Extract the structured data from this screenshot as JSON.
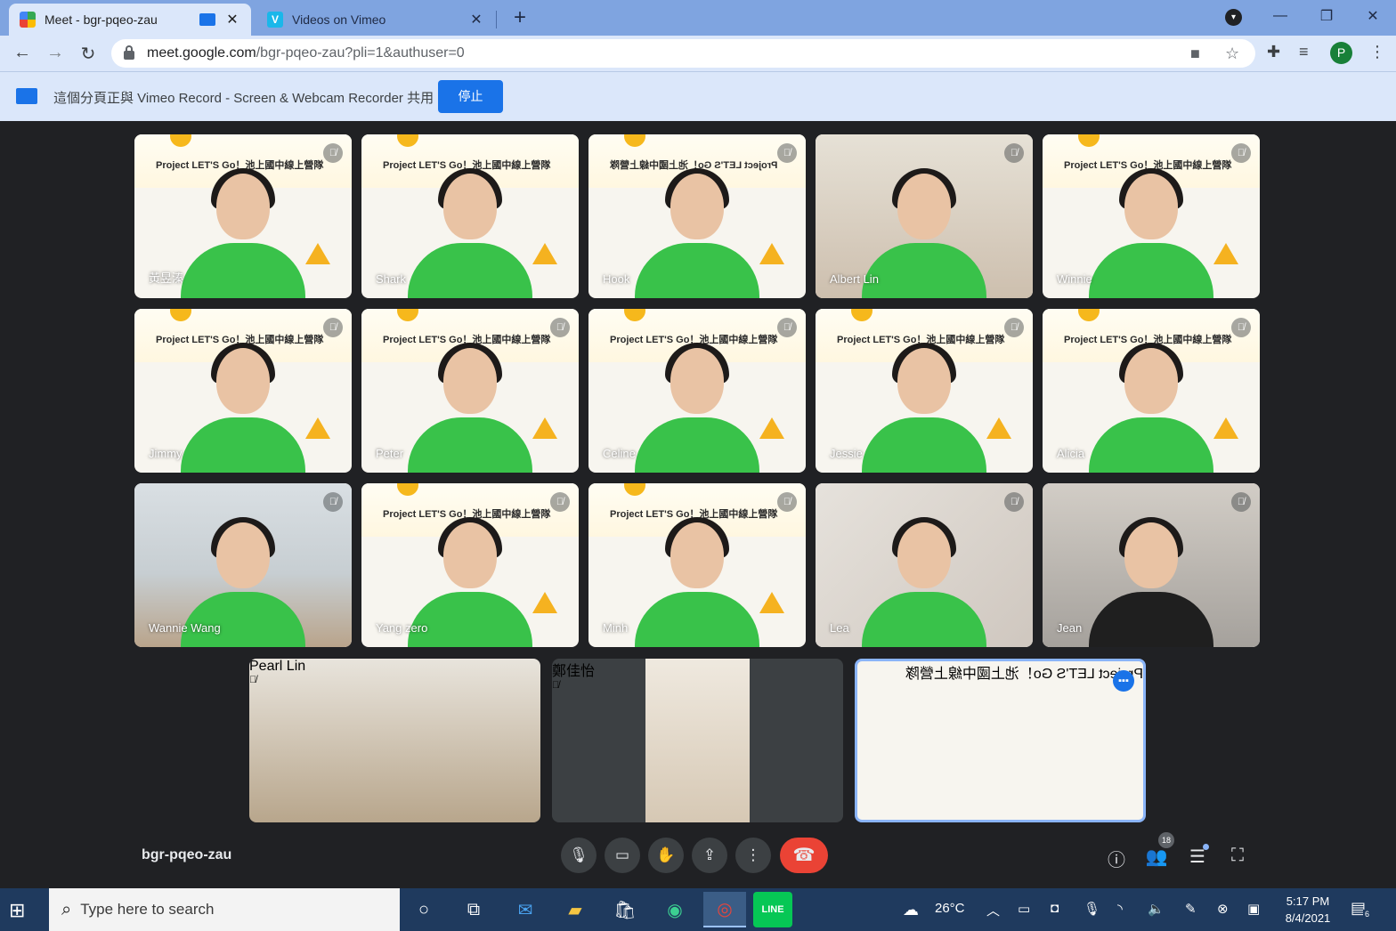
{
  "browser": {
    "tabs": [
      {
        "title": "Meet - bgr-pqeo-zau",
        "favicon": "google-meet-icon",
        "active": true
      },
      {
        "title": "Videos on Vimeo",
        "favicon": "vimeo-icon",
        "active": false
      }
    ],
    "new_tab": "+",
    "window_buttons": {
      "minimize": "—",
      "restore": "❐",
      "close": "✕"
    },
    "url_host": "meet.google.com",
    "url_path": "/bgr-pqeo-zau?pli=1&authuser=0",
    "profile_initial": "P"
  },
  "infobar": {
    "message": "這個分頁正與 Vimeo Record - Screen & Webcam Recorder 共用",
    "stop_label": "停止"
  },
  "participants": [
    {
      "name": "黃昱溱",
      "muted": true
    },
    {
      "name": "Shark",
      "muted": false
    },
    {
      "name": "Hook",
      "muted": true
    },
    {
      "name": "Albert Lin",
      "muted": true
    },
    {
      "name": "Winnie",
      "muted": true
    },
    {
      "name": "Jimmy",
      "muted": true
    },
    {
      "name": "Peter",
      "muted": true
    },
    {
      "name": "Celine",
      "muted": true
    },
    {
      "name": "Jessie",
      "muted": true
    },
    {
      "name": "Alicia",
      "muted": true
    },
    {
      "name": "Wannie Wang",
      "muted": true
    },
    {
      "name": "Yang zero",
      "muted": true
    },
    {
      "name": "Minh",
      "muted": true
    },
    {
      "name": "Lea",
      "muted": true
    },
    {
      "name": "Jean",
      "muted": true
    },
    {
      "name": "Pearl Lin",
      "muted": true
    },
    {
      "name": "鄭佳怡",
      "muted": true
    },
    {
      "name": "",
      "muted": false,
      "speaking": true
    }
  ],
  "banner": {
    "text": "Project LET'S Go！池上國中線上營隊",
    "side_logo": "Projec\nLET'S G"
  },
  "meeting": {
    "code": "bgr-pqeo-zau",
    "participant_count": "18"
  },
  "taskbar": {
    "search_placeholder": "Type here to search",
    "temperature": "26°C",
    "time": "5:17 PM",
    "date": "8/4/2021",
    "notification_count": "6"
  }
}
